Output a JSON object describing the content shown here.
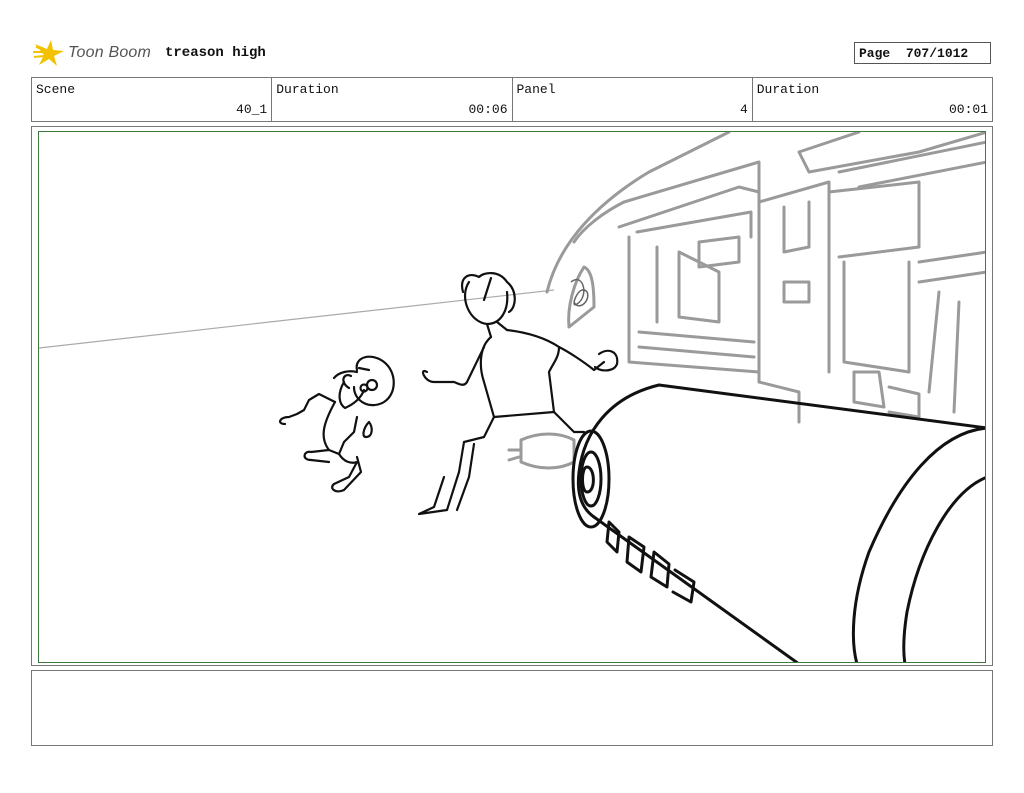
{
  "header": {
    "brand": "Toon Boom",
    "project": "treason high",
    "page_label": "Page",
    "page_value": "707/1012"
  },
  "info": {
    "scene_label": "Scene",
    "scene_value": "40_1",
    "duration1_label": "Duration",
    "duration1_value": "00:06",
    "panel_label": "Panel",
    "panel_value": "4",
    "duration2_label": "Duration",
    "duration2_value": "00:01"
  },
  "notes": {
    "text": ""
  },
  "colors": {
    "frame_border": "#3f7a3f",
    "logo_accent": "#f2c200",
    "sketch_grey": "#9a9a9a"
  }
}
